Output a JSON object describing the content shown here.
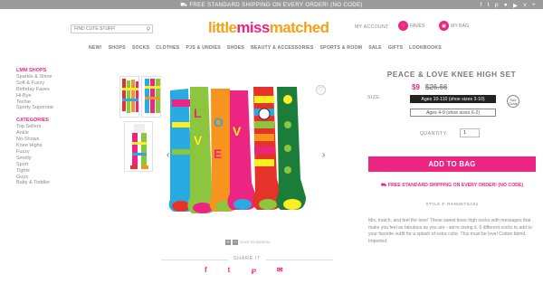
{
  "topbar": {
    "promo": "FREE STANDARD SHIPPING ON EVERY ORDER! (NO CODE)",
    "social_icons": [
      "facebook-icon",
      "twitter-icon",
      "pinterest-icon",
      "instagram-icon",
      "youtube-icon",
      "vine-icon",
      "plus-icon"
    ]
  },
  "header": {
    "search_placeholder": "FIND CUTE STUFF!",
    "logo": {
      "part1": "little",
      "part2": "miss",
      "part3": "matched"
    },
    "account": "MY ACCOUNT",
    "faves": "FAVES",
    "bag": "MY BAG"
  },
  "nav": [
    "NEW!",
    "SHOPS",
    "SOCKS",
    "CLOTHES",
    "PJS & UNDIES",
    "SHOES",
    "BEAUTY & ACCESSORIES",
    "SPORTS & ROOM",
    "SALE",
    "GIFTS",
    "LOOKBOOKS"
  ],
  "sidebar": {
    "shops_heading": "LMM SHOPS",
    "shops": [
      "Sparkle & Shine",
      "Soft & Fuzzy",
      "Birthday Faves",
      "Hi-Bye",
      "Techie",
      "Sporty Superstar"
    ],
    "categories_heading": "CATEGORIES",
    "categories": [
      "Top Sellers",
      "Ankle",
      "No-Shows",
      "Knee Highs",
      "Fuzzy",
      "Smelly",
      "Sport",
      "Tights",
      "Guys",
      "Baby & Toddler"
    ]
  },
  "gallery": {
    "zoom_text": "CLICK TO ZOOM IN",
    "share_label": "SHARE IT"
  },
  "product": {
    "title": "PEACE & LOVE KNEE HIGH SET",
    "price": "$9",
    "was_price": "$26.66",
    "size_label": "SIZE:",
    "size_options": [
      "Ages 10-110 (shoe sizes 3-10)",
      "Ages 4-9 (shoe sizes 6-2)"
    ],
    "size_guide": "Size Guide",
    "quantity_label": "QUANTITY:",
    "quantity_value": "1",
    "add_to_bag": "ADD TO BAG",
    "free_shipping": "FREE STANDARD SHIPPING ON EVERY ORDER! (NO CODE)",
    "style": "STYLE #: R4464KTSAS1",
    "description": "Mix, match, and feel the love! These sweet knee high socks with messages that make you feel as fabulous as you are - we're loving it. 6 different socks to add to your favorite outfit for a splash of extra color. This must be love! Cotton blend. Imported."
  },
  "colors": {
    "brand_pink": "#ec2582",
    "brand_orange": "#f4a21a",
    "topbar_gray": "#9b9b9b"
  }
}
